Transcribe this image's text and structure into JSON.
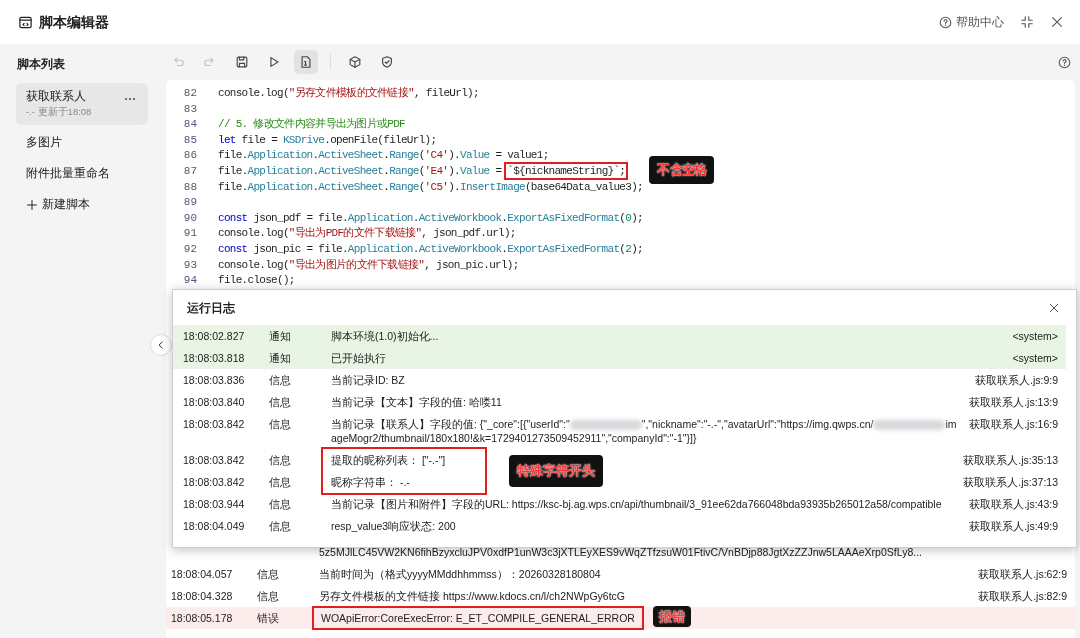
{
  "window": {
    "title": "脚本编辑器",
    "help": "帮助中心"
  },
  "sidebar": {
    "title": "脚本列表",
    "items": [
      {
        "name": "获取联系人",
        "subtitle": "-.- 更新于18:08",
        "selected": true
      },
      {
        "name": "多图片",
        "selected": false
      },
      {
        "name": "附件批量重命名",
        "selected": false
      }
    ],
    "new_button": "新建脚本"
  },
  "toolbar": [
    {
      "kind": "undo",
      "disabled": true,
      "selected": false
    },
    {
      "kind": "redo",
      "disabled": true,
      "selected": false
    },
    {
      "kind": "save",
      "disabled": false,
      "selected": false
    },
    {
      "kind": "run",
      "disabled": false,
      "selected": false
    },
    {
      "kind": "document",
      "disabled": false,
      "selected": true
    },
    {
      "kind": "cube",
      "disabled": false,
      "selected": false
    },
    {
      "kind": "shield",
      "disabled": false,
      "selected": false
    }
  ],
  "editor": {
    "lines": [
      {
        "number": "82",
        "tokens": [
          {
            "text": "console.log(",
            "kind": "plain"
          },
          {
            "text": "\"另存文件模板的文件链接\"",
            "kind": "string"
          },
          {
            "text": ", fileUrl);",
            "kind": "plain"
          }
        ]
      },
      {
        "number": "83"
      },
      {
        "number": "84",
        "tokens": [
          {
            "text": "// 5. 修改文件内容并导出为图片或PDF",
            "kind": "comment"
          }
        ]
      },
      {
        "number": "85",
        "tokens": [
          {
            "text": "let",
            "kind": "keyword"
          },
          {
            "text": " file = ",
            "kind": "plain"
          },
          {
            "text": "KSDrive",
            "kind": "member"
          },
          {
            "text": ".openFile(fileUrl);",
            "kind": "plain"
          }
        ]
      },
      {
        "number": "86",
        "tokens": [
          {
            "text": "file.",
            "kind": "plain"
          },
          {
            "text": "Application",
            "kind": "member"
          },
          {
            "text": ".",
            "kind": "plain"
          },
          {
            "text": "ActiveSheet",
            "kind": "member"
          },
          {
            "text": ".",
            "kind": "plain"
          },
          {
            "text": "Range",
            "kind": "member"
          },
          {
            "text": "(",
            "kind": "plain"
          },
          {
            "text": "'C4'",
            "kind": "string"
          },
          {
            "text": ").",
            "kind": "plain"
          },
          {
            "text": "Value",
            "kind": "member"
          },
          {
            "text": " = value1;",
            "kind": "plain"
          }
        ]
      },
      {
        "number": "87",
        "tokens": [
          {
            "text": "file.",
            "kind": "plain"
          },
          {
            "text": "Application",
            "kind": "member"
          },
          {
            "text": ".",
            "kind": "plain"
          },
          {
            "text": "ActiveSheet",
            "kind": "member"
          },
          {
            "text": ".",
            "kind": "plain"
          },
          {
            "text": "Range",
            "kind": "member"
          },
          {
            "text": "(",
            "kind": "plain"
          },
          {
            "text": "'E4'",
            "kind": "string"
          },
          {
            "text": ").",
            "kind": "plain"
          },
          {
            "text": "Value",
            "kind": "member"
          },
          {
            "text": " = ",
            "kind": "plain"
          },
          {
            "text": "`${nicknameString}`;",
            "kind": "plain",
            "boxed": true
          }
        ],
        "note": "不含空格"
      },
      {
        "number": "88",
        "tokens": [
          {
            "text": "file.",
            "kind": "plain"
          },
          {
            "text": "Application",
            "kind": "member"
          },
          {
            "text": ".",
            "kind": "plain"
          },
          {
            "text": "ActiveSheet",
            "kind": "member"
          },
          {
            "text": ".",
            "kind": "plain"
          },
          {
            "text": "Range",
            "kind": "member"
          },
          {
            "text": "(",
            "kind": "plain"
          },
          {
            "text": "'C5'",
            "kind": "string"
          },
          {
            "text": ").",
            "kind": "plain"
          },
          {
            "text": "InsertImage",
            "kind": "member"
          },
          {
            "text": "(base64Data_value3);",
            "kind": "plain"
          }
        ]
      },
      {
        "number": "89"
      },
      {
        "number": "90",
        "tokens": [
          {
            "text": "const",
            "kind": "keyword"
          },
          {
            "text": " json_pdf = file.",
            "kind": "plain"
          },
          {
            "text": "Application",
            "kind": "member"
          },
          {
            "text": ".",
            "kind": "plain"
          },
          {
            "text": "ActiveWorkbook",
            "kind": "member"
          },
          {
            "text": ".",
            "kind": "plain"
          },
          {
            "text": "ExportAsFixedFormat",
            "kind": "member"
          },
          {
            "text": "(",
            "kind": "plain"
          },
          {
            "text": "0",
            "kind": "number"
          },
          {
            "text": ");",
            "kind": "plain"
          }
        ]
      },
      {
        "number": "91",
        "tokens": [
          {
            "text": "console.log(",
            "kind": "plain"
          },
          {
            "text": "\"导出为PDF的文件下载链接\"",
            "kind": "string"
          },
          {
            "text": ", json_pdf.url);",
            "kind": "plain"
          }
        ]
      },
      {
        "number": "92",
        "tokens": [
          {
            "text": "const",
            "kind": "keyword"
          },
          {
            "text": " json_pic = file.",
            "kind": "plain"
          },
          {
            "text": "Application",
            "kind": "member"
          },
          {
            "text": ".",
            "kind": "plain"
          },
          {
            "text": "ActiveWorkbook",
            "kind": "member"
          },
          {
            "text": ".",
            "kind": "plain"
          },
          {
            "text": "ExportAsFixedFormat",
            "kind": "member"
          },
          {
            "text": "(",
            "kind": "plain"
          },
          {
            "text": "2",
            "kind": "number"
          },
          {
            "text": ");",
            "kind": "plain"
          }
        ]
      },
      {
        "number": "93",
        "tokens": [
          {
            "text": "console.log(",
            "kind": "plain"
          },
          {
            "text": "\"导出为图片的文件下载链接\"",
            "kind": "string"
          },
          {
            "text": ", json_pic.url);",
            "kind": "plain"
          }
        ]
      },
      {
        "number": "94",
        "tokens": [
          {
            "text": "file.close();",
            "kind": "plain"
          }
        ]
      }
    ]
  },
  "background_log": {
    "rows": [
      {
        "kind": "continuation",
        "message": "5z5MJlLC45VW2KN6fihBzyxcluJPV0xdfP1unW3c3jXTLEyXES9vWqZTfzsuW01FtivC/VnBDjp88JgtXzZZJnw5LAAAeXrp0SfLy8..."
      },
      {
        "kind": "info",
        "time": "18:08:04.057",
        "level": "信息",
        "message": "当前时间为（格式yyyyMMddhhmmss）：20260328180804",
        "source": "获取联系人.js:62:9"
      },
      {
        "kind": "info",
        "time": "18:08:04.328",
        "level": "信息",
        "message": "另存文件模板的文件链接 https://www.kdocs.cn/l/ch2NWpGy6tcG",
        "source": "获取联系人.js:82:9"
      },
      {
        "kind": "error",
        "time": "18:08:05.178",
        "level": "错误",
        "message": "WOApiError:CoreExecError: E_ET_COMPILE_GENERAL_ERROR",
        "boxed": true,
        "note": "报错"
      }
    ]
  },
  "log_dialog": {
    "title": "运行日志",
    "box_note": "特殊字符开头",
    "rows": [
      {
        "kind": "notice",
        "time": "18:08:02.827",
        "level": "通知",
        "message": "脚本环境(1.0)初始化...",
        "source": "<system>",
        "boxed": false
      },
      {
        "kind": "notice",
        "time": "18:08:03.818",
        "level": "通知",
        "message": "已开始执行",
        "source": "<system>",
        "boxed": false
      },
      {
        "kind": "info",
        "time": "18:08:03.836",
        "level": "信息",
        "message": "当前记录ID: BZ",
        "source": "获取联系人.js:9:9",
        "boxed": false
      },
      {
        "kind": "info",
        "time": "18:08:03.840",
        "level": "信息",
        "message": "当前记录【文本】字段的值: 哈喽11",
        "source": "获取联系人.js:13:9",
        "boxed": false
      },
      {
        "kind": "info",
        "time": "18:08:03.842",
        "level": "信息",
        "segments": [
          {
            "kind": "text",
            "text": "当前记录【联系人】字段的值: {\"_core\":[{\"userId\":\""
          },
          {
            "kind": "redacted"
          },
          {
            "kind": "text",
            "text": "\",\"nickname\":\"-.-\",\"avatarUrl\":\"https://img.qwps.cn/"
          },
          {
            "kind": "redacted"
          },
          {
            "kind": "text",
            "text": "imageMogr2/thumbnail/180x180!&k=1729401273509452911\",\"companyId\":\"-1\"}]}"
          }
        ],
        "source": "获取联系人.js:16:9",
        "boxed": false
      },
      {
        "kind": "info",
        "time": "18:08:03.842",
        "level": "信息",
        "message": "提取的昵称列表： [\"-.-\"]",
        "source": "获取联系人.js:35:13",
        "boxed": true
      },
      {
        "kind": "info",
        "time": "18:08:03.842",
        "level": "信息",
        "message": "昵称字符串： -.-",
        "source": "获取联系人.js:37:13",
        "boxed": true
      },
      {
        "kind": "info",
        "time": "18:08:03.944",
        "level": "信息",
        "message": "当前记录【图片和附件】字段的URL: https://ksc-bj.ag.wps.cn/api/thumbnail/3_91ee62da766048bda93935b265012a58/compatible",
        "source": "获取联系人.js:43:9",
        "boxed": false
      },
      {
        "kind": "info",
        "time": "18:08:04.049",
        "level": "信息",
        "message": "resp_value3响应状态: 200",
        "source": "获取联系人.js:49:9",
        "boxed": false
      }
    ]
  }
}
